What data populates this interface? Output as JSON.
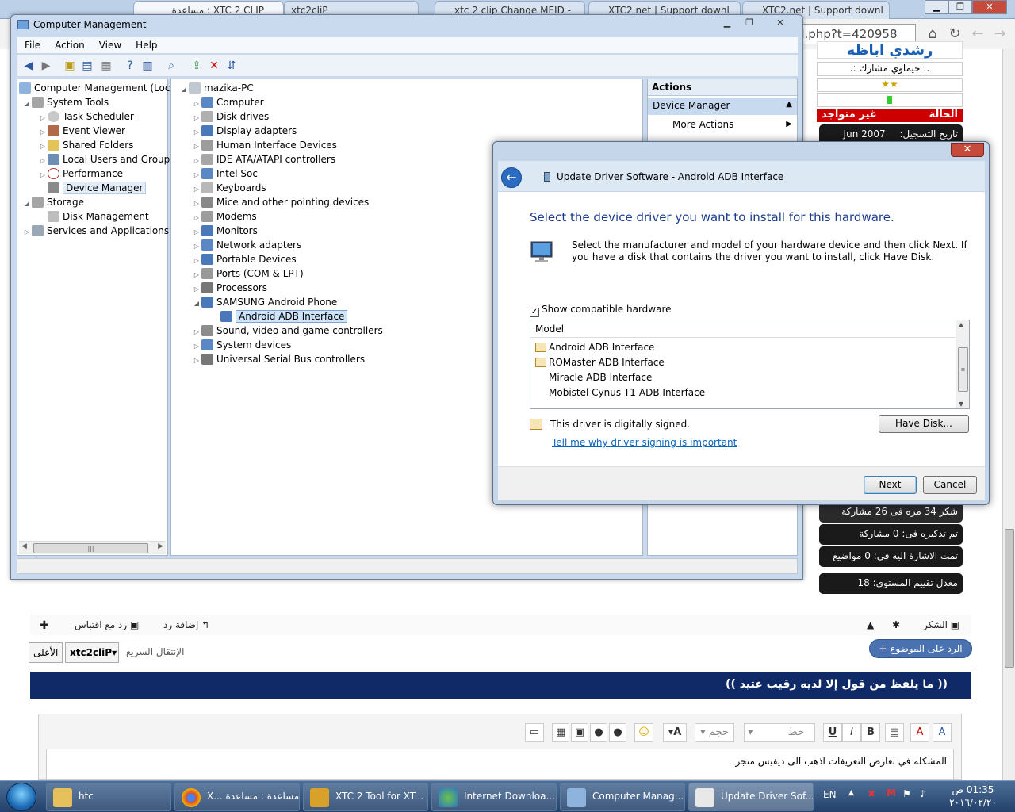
{
  "browser": {
    "tabs": [
      {
        "label": "XTC 2 CLIP : مساعدة"
      },
      {
        "label": "xtc2cliP"
      },
      {
        "label": "xtc 2 clip Change MEID -"
      },
      {
        "label": "XTC2.net | Support downl"
      },
      {
        "label": "XTC2.net | Support downl"
      }
    ],
    "url": "d.php?t=420958"
  },
  "forum": {
    "user_name": "رشدي اباظه",
    "user_rank": ".: جيماوي مشارك :.",
    "status_label": "الحالة",
    "status_value": "غير متواجد",
    "join_label": "تاريخ التسجيل:",
    "join_value": "Jun 2007",
    "thanks": "شكر 34 مره فى 26 مشاركة",
    "mentions": "تم تذكيره فى: 0 مشاركة",
    "tagged": "تمت الاشارة اليه فى: 0 مواضيع",
    "rating": "معدل تقييم المستوى: 18",
    "post_actions": {
      "reply": "إضافة رد",
      "quote": "رد مع اقتباس",
      "thanks": "الشكر"
    },
    "quick_jump_label": "الإنتقال السريع",
    "quick_jump_value": "xtc2cliP",
    "top_label": "الأعلى",
    "reply_topic": "+ الرد على الموضوع",
    "banner": "(( ما يلفظ من قول إلا لديه رقيب عتيد ))",
    "editor_font": "خط",
    "editor_size": "حجم",
    "editor_text": "المشكلة في تعارض التعريفات اذهب الى ديفيس منجر"
  },
  "cm": {
    "title": "Computer Management",
    "menu": [
      "File",
      "Action",
      "View",
      "Help"
    ],
    "left_tree": [
      {
        "label": "Computer Management (Local",
        "level": 0
      },
      {
        "label": "System Tools",
        "level": 1
      },
      {
        "label": "Task Scheduler",
        "level": 2
      },
      {
        "label": "Event Viewer",
        "level": 2
      },
      {
        "label": "Shared Folders",
        "level": 2
      },
      {
        "label": "Local Users and Groups",
        "level": 2
      },
      {
        "label": "Performance",
        "level": 2
      },
      {
        "label": "Device Manager",
        "level": 2
      },
      {
        "label": "Storage",
        "level": 1
      },
      {
        "label": "Disk Management",
        "level": 2
      },
      {
        "label": "Services and Applications",
        "level": 1
      }
    ],
    "device_root": "mazika-PC",
    "devices": [
      "Computer",
      "Disk drives",
      "Display adapters",
      "Human Interface Devices",
      "IDE ATA/ATAPI controllers",
      "Intel Soc",
      "Keyboards",
      "Mice and other pointing devices",
      "Modems",
      "Monitors",
      "Network adapters",
      "Portable Devices",
      "Ports (COM & LPT)",
      "Processors",
      "SAMSUNG Android Phone",
      "Android ADB Interface",
      "Sound, video and game controllers",
      "System devices",
      "Universal Serial Bus controllers"
    ],
    "actions_header": "Actions",
    "actions_selected": "Device Manager",
    "actions_more": "More Actions"
  },
  "dialog": {
    "title": "Update Driver Software - Android ADB Interface",
    "heading": "Select the device driver you want to install for this hardware.",
    "description": "Select the manufacturer and model of your hardware device and then click Next. If you have a disk that contains the driver you want to install, click Have Disk.",
    "show_compatible": "Show compatible hardware",
    "show_compatible_checked": true,
    "model_header": "Model",
    "models": [
      {
        "label": "Android ADB Interface",
        "signed": true
      },
      {
        "label": "ROMaster ADB Interface",
        "signed": true
      },
      {
        "label": "Miracle ADB Interface",
        "signed": false
      },
      {
        "label": "Mobistel Cynus T1-ADB Interface",
        "signed": false
      }
    ],
    "signed_text": "This driver is digitally signed.",
    "signing_link": "Tell me why driver signing is important",
    "have_disk": "Have Disk...",
    "next": "Next",
    "cancel": "Cancel"
  },
  "taskbar": {
    "items": [
      {
        "label": "htc"
      },
      {
        "label": "X... مساعدة : مساعدة"
      },
      {
        "label": "XTC 2 Tool for XT..."
      },
      {
        "label": "Internet Downloa..."
      },
      {
        "label": "Computer Manag..."
      },
      {
        "label": "Update Driver Sof..."
      }
    ],
    "lang": "EN",
    "time": "01:35 ص",
    "date": "٢٠١٦/٠٢/٢٠"
  }
}
